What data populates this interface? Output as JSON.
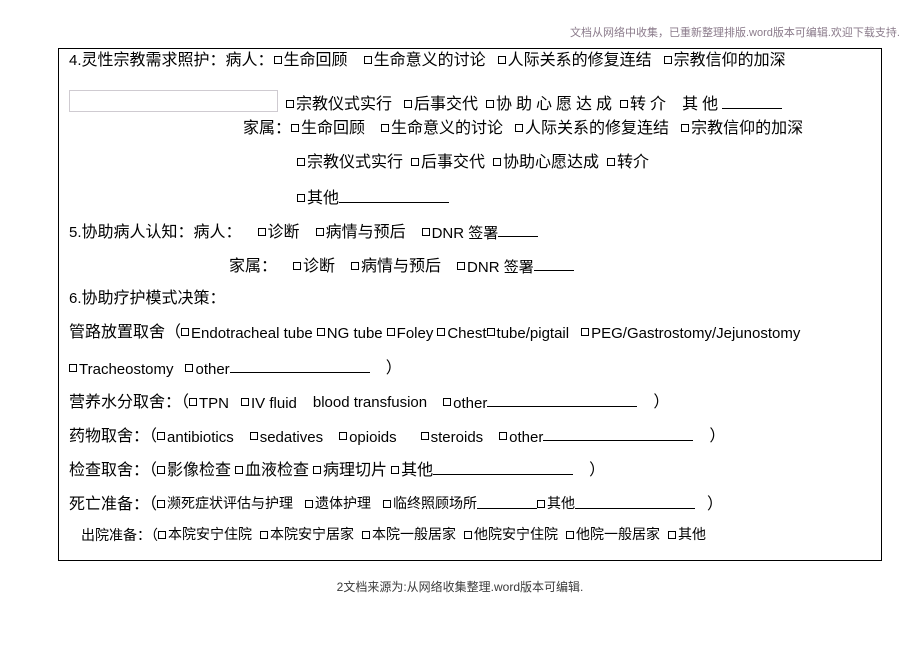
{
  "watermark": {
    "top": "文档从网络中收集，已重新整理排版.word版本可编辑.欢迎下载支持.",
    "bottom": "2文档来源为:从网络收集整理.word版本可编辑."
  },
  "form": {
    "section4": {
      "number": "4.",
      "title": "灵性宗教需求照护：",
      "patient_label": "病人：",
      "family_label": "家属：",
      "patient_options_line1": [
        "生命回顾",
        "生命意义的讨论",
        "人际关系的修复连结",
        "宗教信仰的加深"
      ],
      "patient_options_line2": [
        "宗教仪式实行",
        "后事交代",
        "协 助 心 愿 达 成",
        "转 介"
      ],
      "patient_other_label": "其 他",
      "family_options_line1": [
        "生命回顾",
        "生命意义的讨论",
        "人际关系的修复连结",
        "宗教信仰的加深"
      ],
      "family_options_line2": [
        "宗教仪式实行",
        "后事交代",
        "协助心愿达成",
        "转介"
      ],
      "family_other_label": "其他"
    },
    "section5": {
      "number": "5.",
      "title": "协助病人认知：",
      "patient_label": "病人：",
      "family_label": "家属：",
      "patient_options": [
        "诊断",
        "病情与预后"
      ],
      "patient_dnr": "DNR 签署",
      "family_options": [
        "诊断",
        "病情与预后"
      ],
      "family_dnr": "DNR 签署"
    },
    "section6": {
      "number": "6.",
      "title": "协助疗护模式决策：",
      "tubes": {
        "label": "管路放置取舍（",
        "options_line1": [
          "Endotracheal tube",
          "NG tube",
          "Foley",
          "Chest",
          "tube/pigtail",
          "PEG/Gastrostomy/Jejunostomy"
        ],
        "options_line2": [
          "Tracheostomy",
          "other"
        ],
        "close_paren": "）"
      },
      "nutrition": {
        "label": "营养水分取舍：（",
        "options": [
          "TPN",
          "IV fluid",
          "blood transfusion",
          "other"
        ],
        "close_paren": "）"
      },
      "medication": {
        "label": "药物取舍：（",
        "options": [
          "antibiotics",
          "sedatives",
          "opioids",
          "steroids",
          "other"
        ],
        "close_paren": "）"
      },
      "exams": {
        "label": "检查取舍：（",
        "options": [
          "影像检查",
          "血液检查",
          "病理切片",
          "其他"
        ],
        "close_paren": "）"
      },
      "death_prep": {
        "label": "死亡准备：（",
        "options": [
          "濒死症状评估与护理",
          "遗体护理",
          "临终照顾场所",
          "其他"
        ],
        "close_paren": "）"
      },
      "discharge_prep": {
        "label": "出院准备：（",
        "options": [
          "本院安宁住院",
          "本院安宁居家",
          "本院一般居家",
          "他院安宁住院",
          "他院一般居家",
          "其他"
        ]
      }
    }
  }
}
